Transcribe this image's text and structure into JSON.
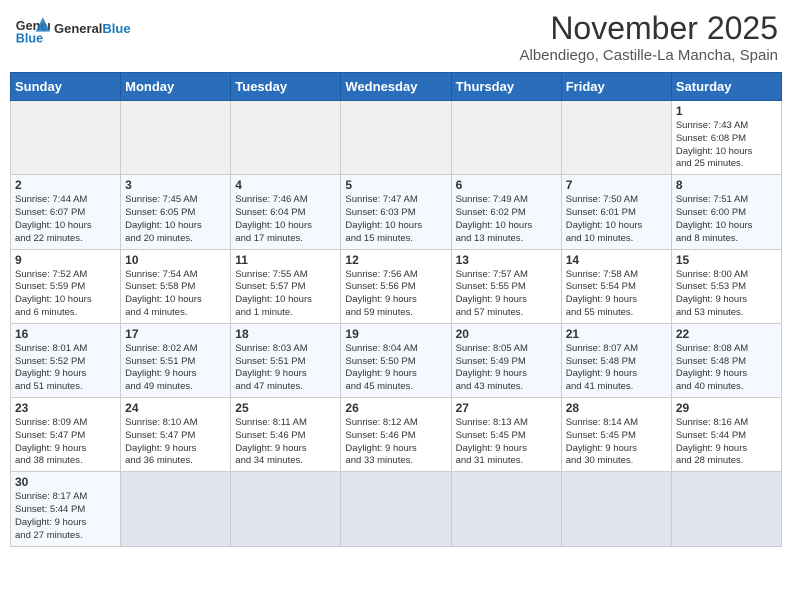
{
  "header": {
    "logo_text_general": "General",
    "logo_text_blue": "Blue",
    "month_title": "November 2025",
    "subtitle": "Albendiego, Castille-La Mancha, Spain"
  },
  "days_of_week": [
    "Sunday",
    "Monday",
    "Tuesday",
    "Wednesday",
    "Thursday",
    "Friday",
    "Saturday"
  ],
  "weeks": [
    {
      "row_class": "row-odd",
      "days": [
        {
          "num": "",
          "info": "",
          "empty": true
        },
        {
          "num": "",
          "info": "",
          "empty": true
        },
        {
          "num": "",
          "info": "",
          "empty": true
        },
        {
          "num": "",
          "info": "",
          "empty": true
        },
        {
          "num": "",
          "info": "",
          "empty": true
        },
        {
          "num": "",
          "info": "",
          "empty": true
        },
        {
          "num": "1",
          "info": "Sunrise: 7:43 AM\nSunset: 6:08 PM\nDaylight: 10 hours\nand 25 minutes.",
          "empty": false
        }
      ]
    },
    {
      "row_class": "row-even",
      "days": [
        {
          "num": "2",
          "info": "Sunrise: 7:44 AM\nSunset: 6:07 PM\nDaylight: 10 hours\nand 22 minutes.",
          "empty": false
        },
        {
          "num": "3",
          "info": "Sunrise: 7:45 AM\nSunset: 6:05 PM\nDaylight: 10 hours\nand 20 minutes.",
          "empty": false
        },
        {
          "num": "4",
          "info": "Sunrise: 7:46 AM\nSunset: 6:04 PM\nDaylight: 10 hours\nand 17 minutes.",
          "empty": false
        },
        {
          "num": "5",
          "info": "Sunrise: 7:47 AM\nSunset: 6:03 PM\nDaylight: 10 hours\nand 15 minutes.",
          "empty": false
        },
        {
          "num": "6",
          "info": "Sunrise: 7:49 AM\nSunset: 6:02 PM\nDaylight: 10 hours\nand 13 minutes.",
          "empty": false
        },
        {
          "num": "7",
          "info": "Sunrise: 7:50 AM\nSunset: 6:01 PM\nDaylight: 10 hours\nand 10 minutes.",
          "empty": false
        },
        {
          "num": "8",
          "info": "Sunrise: 7:51 AM\nSunset: 6:00 PM\nDaylight: 10 hours\nand 8 minutes.",
          "empty": false
        }
      ]
    },
    {
      "row_class": "row-odd",
      "days": [
        {
          "num": "9",
          "info": "Sunrise: 7:52 AM\nSunset: 5:59 PM\nDaylight: 10 hours\nand 6 minutes.",
          "empty": false
        },
        {
          "num": "10",
          "info": "Sunrise: 7:54 AM\nSunset: 5:58 PM\nDaylight: 10 hours\nand 4 minutes.",
          "empty": false
        },
        {
          "num": "11",
          "info": "Sunrise: 7:55 AM\nSunset: 5:57 PM\nDaylight: 10 hours\nand 1 minute.",
          "empty": false
        },
        {
          "num": "12",
          "info": "Sunrise: 7:56 AM\nSunset: 5:56 PM\nDaylight: 9 hours\nand 59 minutes.",
          "empty": false
        },
        {
          "num": "13",
          "info": "Sunrise: 7:57 AM\nSunset: 5:55 PM\nDaylight: 9 hours\nand 57 minutes.",
          "empty": false
        },
        {
          "num": "14",
          "info": "Sunrise: 7:58 AM\nSunset: 5:54 PM\nDaylight: 9 hours\nand 55 minutes.",
          "empty": false
        },
        {
          "num": "15",
          "info": "Sunrise: 8:00 AM\nSunset: 5:53 PM\nDaylight: 9 hours\nand 53 minutes.",
          "empty": false
        }
      ]
    },
    {
      "row_class": "row-even",
      "days": [
        {
          "num": "16",
          "info": "Sunrise: 8:01 AM\nSunset: 5:52 PM\nDaylight: 9 hours\nand 51 minutes.",
          "empty": false
        },
        {
          "num": "17",
          "info": "Sunrise: 8:02 AM\nSunset: 5:51 PM\nDaylight: 9 hours\nand 49 minutes.",
          "empty": false
        },
        {
          "num": "18",
          "info": "Sunrise: 8:03 AM\nSunset: 5:51 PM\nDaylight: 9 hours\nand 47 minutes.",
          "empty": false
        },
        {
          "num": "19",
          "info": "Sunrise: 8:04 AM\nSunset: 5:50 PM\nDaylight: 9 hours\nand 45 minutes.",
          "empty": false
        },
        {
          "num": "20",
          "info": "Sunrise: 8:05 AM\nSunset: 5:49 PM\nDaylight: 9 hours\nand 43 minutes.",
          "empty": false
        },
        {
          "num": "21",
          "info": "Sunrise: 8:07 AM\nSunset: 5:48 PM\nDaylight: 9 hours\nand 41 minutes.",
          "empty": false
        },
        {
          "num": "22",
          "info": "Sunrise: 8:08 AM\nSunset: 5:48 PM\nDaylight: 9 hours\nand 40 minutes.",
          "empty": false
        }
      ]
    },
    {
      "row_class": "row-odd",
      "days": [
        {
          "num": "23",
          "info": "Sunrise: 8:09 AM\nSunset: 5:47 PM\nDaylight: 9 hours\nand 38 minutes.",
          "empty": false
        },
        {
          "num": "24",
          "info": "Sunrise: 8:10 AM\nSunset: 5:47 PM\nDaylight: 9 hours\nand 36 minutes.",
          "empty": false
        },
        {
          "num": "25",
          "info": "Sunrise: 8:11 AM\nSunset: 5:46 PM\nDaylight: 9 hours\nand 34 minutes.",
          "empty": false
        },
        {
          "num": "26",
          "info": "Sunrise: 8:12 AM\nSunset: 5:46 PM\nDaylight: 9 hours\nand 33 minutes.",
          "empty": false
        },
        {
          "num": "27",
          "info": "Sunrise: 8:13 AM\nSunset: 5:45 PM\nDaylight: 9 hours\nand 31 minutes.",
          "empty": false
        },
        {
          "num": "28",
          "info": "Sunrise: 8:14 AM\nSunset: 5:45 PM\nDaylight: 9 hours\nand 30 minutes.",
          "empty": false
        },
        {
          "num": "29",
          "info": "Sunrise: 8:16 AM\nSunset: 5:44 PM\nDaylight: 9 hours\nand 28 minutes.",
          "empty": false
        }
      ]
    },
    {
      "row_class": "row-even",
      "days": [
        {
          "num": "30",
          "info": "Sunrise: 8:17 AM\nSunset: 5:44 PM\nDaylight: 9 hours\nand 27 minutes.",
          "empty": false
        },
        {
          "num": "",
          "info": "",
          "empty": true
        },
        {
          "num": "",
          "info": "",
          "empty": true
        },
        {
          "num": "",
          "info": "",
          "empty": true
        },
        {
          "num": "",
          "info": "",
          "empty": true
        },
        {
          "num": "",
          "info": "",
          "empty": true
        },
        {
          "num": "",
          "info": "",
          "empty": true
        }
      ]
    }
  ]
}
